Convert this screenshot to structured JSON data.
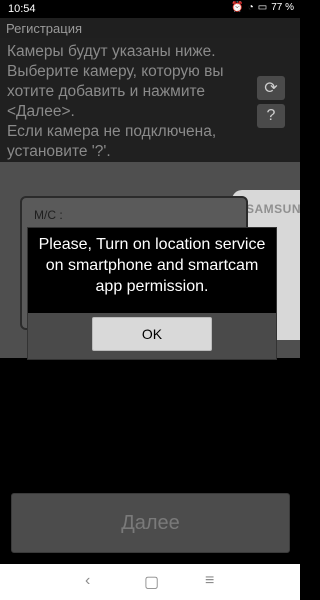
{
  "statusbar": {
    "time": "10:54",
    "battery": "77 %"
  },
  "title": "Регистрация",
  "instructions": "Камеры будут указаны ниже.\nВыберите камеру, которую вы хотите добавить и нажмите <Далее>.\nЕсли камера не подключена, установите '?'.",
  "buttons": {
    "refresh_icon": "refresh-icon",
    "help_label": "?",
    "next_label": "Далее"
  },
  "camera_preview": {
    "brand_text": "SAMSUNG",
    "label_text": "M/C :"
  },
  "dialog": {
    "message": "Please, Turn on location service on smartphone and smartcam app permission.",
    "ok_label": "OK"
  },
  "colors": {
    "background": "#000000",
    "dialog_footer": "#4a4a4a",
    "ok_button": "#d9d9d9"
  }
}
